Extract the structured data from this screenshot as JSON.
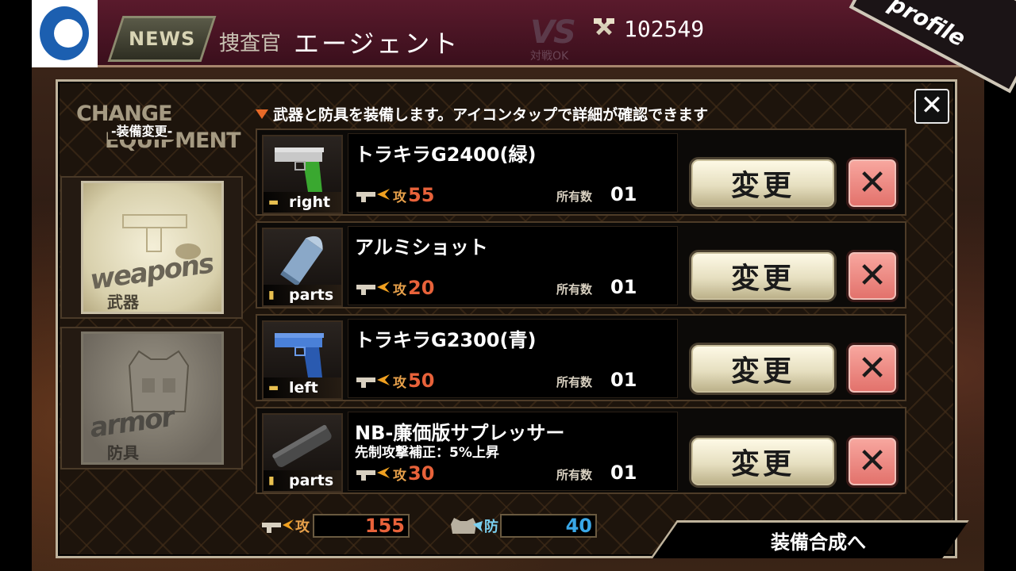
{
  "header": {
    "news_label": "NEWS",
    "agent_rank": "捜査官",
    "agent_name": "エージェント",
    "vs_label": "VS",
    "vs_status": "対戦OK",
    "points": "102549",
    "profile_label": "profile"
  },
  "panel": {
    "title_en_line1": "CHANGE",
    "title_en_line2": "EQUIPMENT",
    "title_jp": "-装備変更-",
    "instruction": "武器と防具を装備します。アイコンタップで詳細が確認できます",
    "close_label": "✕"
  },
  "categories": [
    {
      "label_en": "weapons",
      "label_jp": "武器"
    },
    {
      "label_en": "armor",
      "label_jp": "防具"
    }
  ],
  "equipment": [
    {
      "slot": "right",
      "name": "トラキラG2400(緑)",
      "desc": "",
      "atk_label": "攻",
      "atk": "55",
      "own_label": "所有数",
      "own": "01",
      "change_label": "変更",
      "remove_label": "✕",
      "color": "#3aa830"
    },
    {
      "slot": "parts",
      "name": "アルミショット",
      "desc": "",
      "atk_label": "攻",
      "atk": "20",
      "own_label": "所有数",
      "own": "01",
      "change_label": "変更",
      "remove_label": "✕",
      "color": "#7fa0c8"
    },
    {
      "slot": "left",
      "name": "トラキラG2300(青)",
      "desc": "",
      "atk_label": "攻",
      "atk": "50",
      "own_label": "所有数",
      "own": "01",
      "change_label": "変更",
      "remove_label": "✕",
      "color": "#3a70d0"
    },
    {
      "slot": "parts",
      "name": "NB-廉価版サプレッサー",
      "desc": "先制攻撃補正：5%上昇",
      "atk_label": "攻",
      "atk": "30",
      "own_label": "所有数",
      "own": "01",
      "change_label": "変更",
      "remove_label": "✕",
      "color": "#4a4a4a"
    }
  ],
  "totals": {
    "atk_label": "攻",
    "atk_value": "155",
    "def_label": "防",
    "def_value": "40",
    "atk_color": "#e8623a",
    "def_color": "#3aa8e8"
  },
  "synth_label": "装備合成へ"
}
